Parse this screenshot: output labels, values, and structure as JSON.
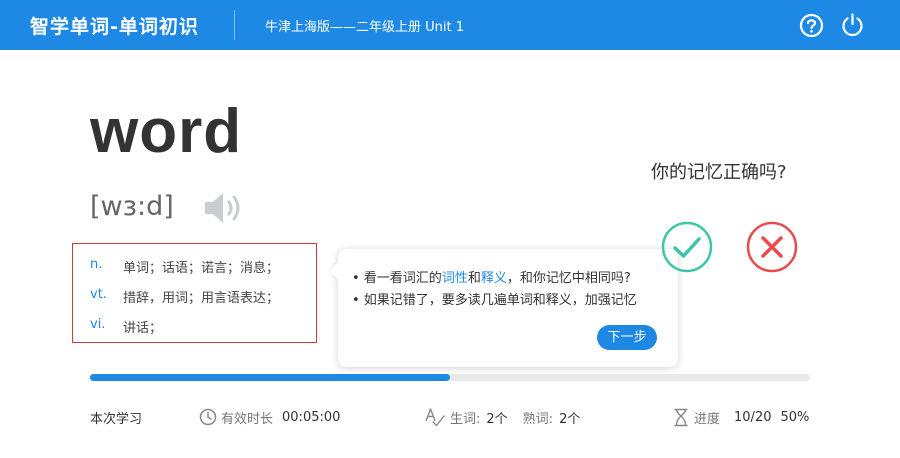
{
  "header": {
    "app_title": "智学单词-单词初识",
    "book_title": "牛津上海版——二年级上册 Unit 1",
    "icons": [
      "help-icon",
      "power-icon"
    ],
    "background_color": "#1e88e5"
  },
  "word_card": {
    "word": "word",
    "phonetic": "[wɜ:d]",
    "speaker_icon": "speaker-icon",
    "definitions": [
      {
        "pos": "n.",
        "meaning": "单词；话语；诺言；消息；"
      },
      {
        "pos": "vt.",
        "meaning": "措辞，用词；用言语表达；"
      },
      {
        "pos": "vi.",
        "meaning": "讲话；"
      }
    ]
  },
  "tooltip": {
    "line1_pre": "• 看一看词汇的",
    "line1_hl1": "词性",
    "line1_mid": "和",
    "line1_hl2": "释义",
    "line1_post": "，和你记忆中相同吗?",
    "line2": "• 如果记错了，要多读几遍单词和释义，加强记忆",
    "next_label": "下一步"
  },
  "memory_check": {
    "question": "你的记忆正确吗?",
    "correct_icon": "check-icon",
    "wrong_icon": "cross-icon",
    "correct_color": "#3cc6a8",
    "wrong_color": "#e84a4f"
  },
  "progress": {
    "fraction": 0.5
  },
  "stats": {
    "session_label": "本次学习",
    "time_label": "有效时长",
    "time_value": "00:05:00",
    "new_label": "生词:",
    "new_value": "2个",
    "familiar_label": "熟词:",
    "familiar_value": "2个",
    "progress_label": "进度",
    "progress_count": "10/20",
    "progress_percent": "50%"
  }
}
